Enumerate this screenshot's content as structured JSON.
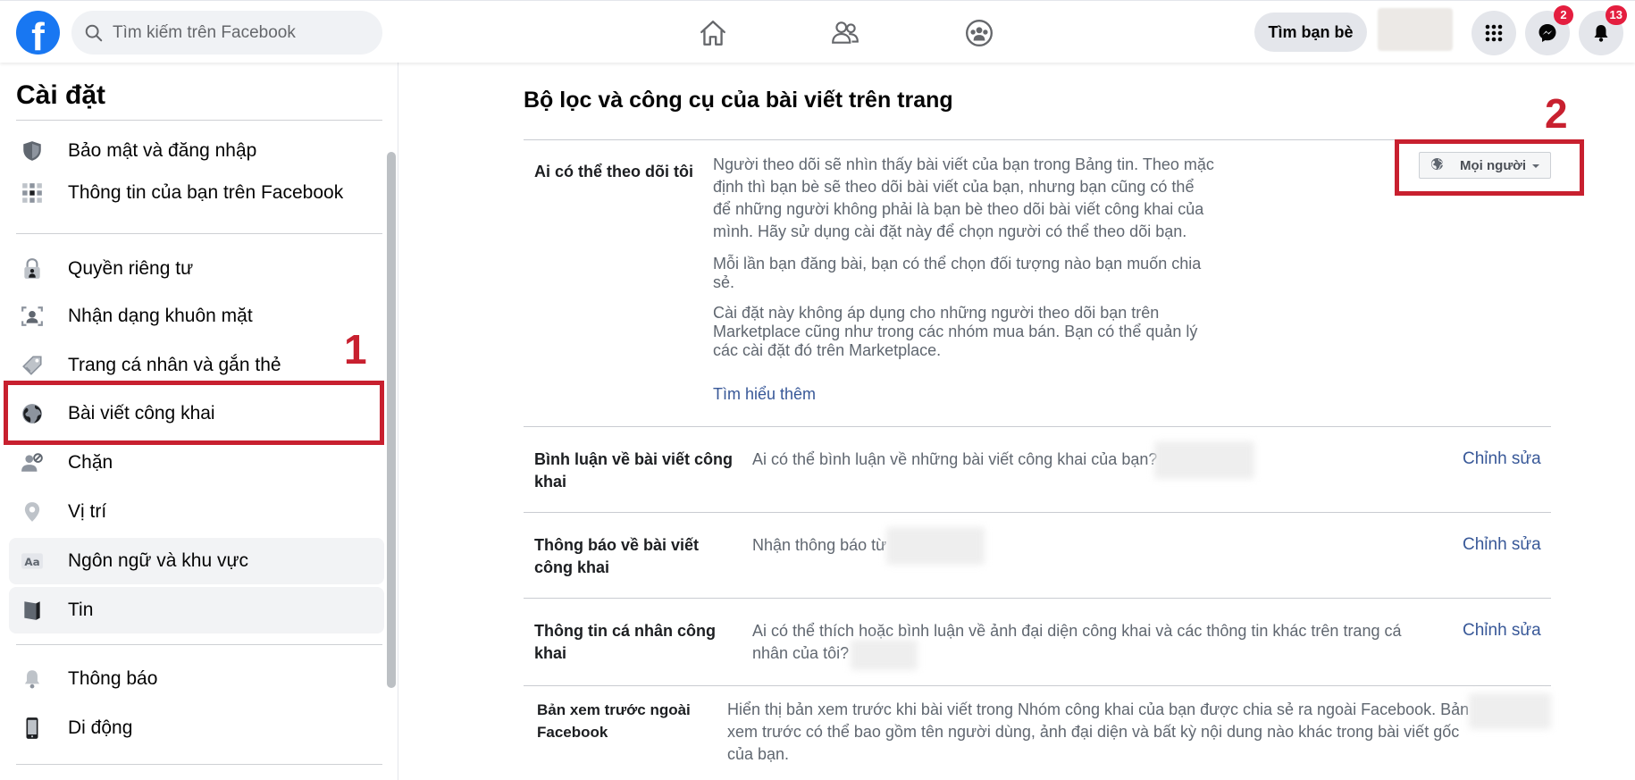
{
  "topbar": {
    "logo": "f",
    "search_placeholder": "Tìm kiếm trên Facebook",
    "nav_icons": [
      "home-icon",
      "friends-icon",
      "groups-icon"
    ],
    "find_friends": "Tìm bạn bè",
    "menu_icon": "grid-menu-icon",
    "messenger_icon": "messenger-icon",
    "messenger_badge": "2",
    "notifications_icon": "bell-icon",
    "notifications_badge": "13"
  },
  "sidebar": {
    "title": "Cài đặt",
    "items": [
      {
        "label": "Bảo mật và đăng nhập",
        "icon": "shield-icon"
      },
      {
        "label": "Thông tin của bạn trên Facebook",
        "icon": "grid-info-icon"
      },
      {
        "label": "Quyền riêng tư",
        "icon": "lock-icon"
      },
      {
        "label": "Nhận dạng khuôn mặt",
        "icon": "face-recognition-icon"
      },
      {
        "label": "Trang cá nhân và gắn thẻ",
        "icon": "tag-icon"
      },
      {
        "label": "Bài viết công khai",
        "icon": "globe-icon"
      },
      {
        "label": "Chặn",
        "icon": "block-user-icon"
      },
      {
        "label": "Vị trí",
        "icon": "location-pin-icon"
      },
      {
        "label": "Ngôn ngữ và khu vực",
        "icon": "language-icon"
      },
      {
        "label": "Tin",
        "icon": "story-icon"
      },
      {
        "label": "Thông báo",
        "icon": "bell-icon"
      },
      {
        "label": "Di động",
        "icon": "mobile-icon"
      }
    ],
    "selected": "Bài viết công khai"
  },
  "annotations": {
    "marker1": "1",
    "marker2": "2",
    "color": "#c8202f"
  },
  "main": {
    "title": "Bộ lọc và công cụ của bài viết trên trang",
    "follow": {
      "label": "Ai có thể theo dõi tôi",
      "p1": "Người theo dõi sẽ nhìn thấy bài viết của bạn trong Bảng tin. Theo mặc định thì bạn bè sẽ theo dõi bài viết của bạn, nhưng bạn cũng có thể để những người không phải là bạn bè theo dõi bài viết công khai của mình. Hãy sử dụng cài đặt này để chọn người có thể theo dõi bạn.",
      "p2": "Mỗi lần bạn đăng bài, bạn có thể chọn đối tượng nào bạn muốn chia sẻ.",
      "p3": "Cài đặt này không áp dụng cho những người theo dõi bạn trên Marketplace cũng như trong các nhóm mua bán. Bạn có thể quản lý các cài đặt đó trên Marketplace.",
      "learn_more": "Tìm hiểu thêm",
      "dropdown_value": "Mọi người"
    },
    "rows": [
      {
        "label": "Bình luận về bài viết công khai",
        "desc": "Ai có thể bình luận về những bài viết công khai của bạn?",
        "action": "Chỉnh sửa"
      },
      {
        "label": "Thông báo về bài viết công khai",
        "desc": "Nhận thông báo từ",
        "action": "Chỉnh sửa"
      },
      {
        "label": "Thông tin cá nhân công khai",
        "desc": "Ai có thể thích hoặc bình luận về ảnh đại diện công khai và các thông tin khác trên trang cá nhân của tôi?",
        "action": "Chỉnh sửa"
      },
      {
        "label": "Bản xem trước ngoài Facebook",
        "desc": "Hiển thị bản xem trước khi bài viết trong Nhóm công khai của bạn được chia sẻ ra ngoài Facebook. Bản xem trước có thể bao gồm tên người dùng, ảnh đại diện và bất kỳ nội dung nào khác trong bài viết gốc của bạn."
      }
    ]
  },
  "colors": {
    "brand": "#1877f2",
    "link": "#385898",
    "highlight": "#c8202f"
  }
}
